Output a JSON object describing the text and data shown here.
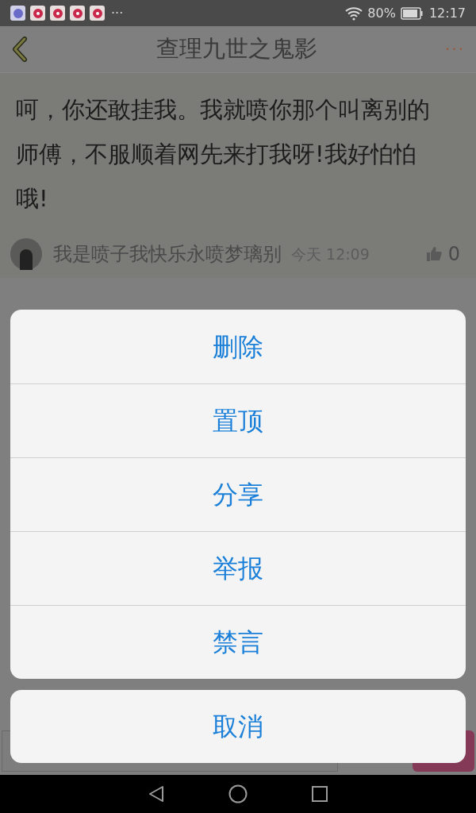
{
  "status_bar": {
    "more": "···",
    "battery": "80%",
    "time": "12:17"
  },
  "header": {
    "title": "查理九世之鬼影",
    "menu": "···"
  },
  "post": {
    "text": "呵，你还敢挂我。我就喷你那个叫离别的师傅，不服顺着网先来打我呀!我好怕怕哦!",
    "author": "我是喷子我快乐永喷梦璃别",
    "time": "今天 12:09",
    "likes": "0"
  },
  "action_sheet": {
    "actions": [
      "删除",
      "置顶",
      "分享",
      "举报",
      "禁言"
    ],
    "cancel": "取消"
  }
}
